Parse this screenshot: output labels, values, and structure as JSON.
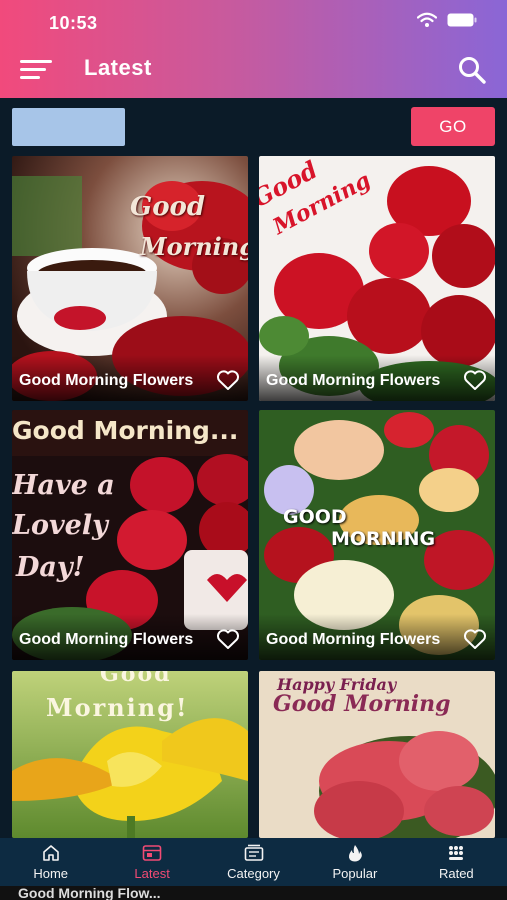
{
  "status_bar": {
    "time": "10:53"
  },
  "header": {
    "title": "Latest"
  },
  "search": {
    "value": "",
    "go_label": "GO"
  },
  "cards": [
    {
      "caption": "Good Morning Flowers",
      "art_text": [
        "Good",
        "Morning"
      ]
    },
    {
      "caption": "Good Morning Flowers",
      "art_text": [
        "Good",
        "Morning"
      ]
    },
    {
      "caption": "Good Morning Flowers",
      "art_text": [
        "Good Morning...",
        "Have a",
        "Lovely",
        "Day!"
      ]
    },
    {
      "caption": "Good Morning Flowers",
      "art_text": [
        "GOOD",
        "MORNING"
      ]
    },
    {
      "caption": "",
      "art_text": [
        "Good",
        "Morning!"
      ]
    },
    {
      "caption": "",
      "art_text": [
        "Happy Friday",
        "Good Morning"
      ]
    }
  ],
  "bottom_nav": {
    "items": [
      {
        "label": "Home",
        "icon": "home-icon"
      },
      {
        "label": "Latest",
        "icon": "latest-icon",
        "active": true
      },
      {
        "label": "Category",
        "icon": "category-icon"
      },
      {
        "label": "Popular",
        "icon": "fire-icon"
      },
      {
        "label": "Rated",
        "icon": "rated-icon"
      }
    ]
  },
  "peek_row": {
    "caption": "Good Morning Flow..."
  },
  "colors": {
    "accent": "#f24b74",
    "header_start": "#f14a7c",
    "header_end": "#8a66d6",
    "nav_bg": "#0d2b42",
    "go_bg": "#ef4468"
  }
}
